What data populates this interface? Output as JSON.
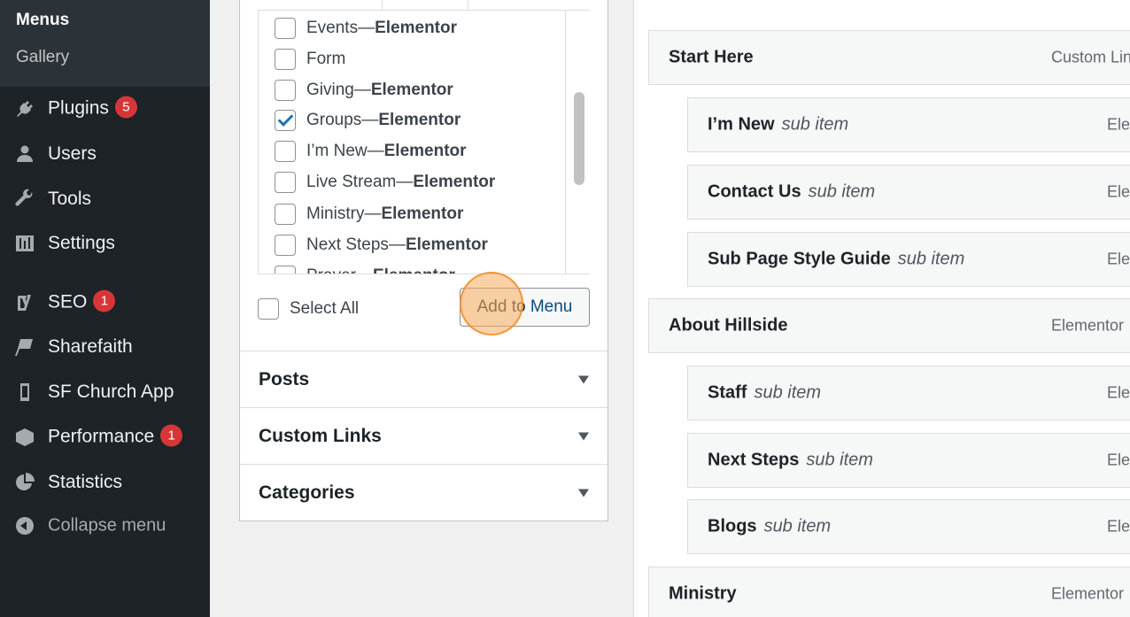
{
  "sidebar": {
    "submenu": [
      {
        "label": "Menus",
        "current": true
      },
      {
        "label": "Gallery",
        "current": false
      }
    ],
    "items": [
      {
        "label": "Plugins",
        "badge": "5",
        "icon": "plugins-icon"
      },
      {
        "label": "Users",
        "badge": "",
        "icon": "users-icon"
      },
      {
        "label": "Tools",
        "badge": "",
        "icon": "tools-icon"
      },
      {
        "label": "Settings",
        "badge": "",
        "icon": "settings-icon"
      },
      {
        "label": "SEO",
        "badge": "1",
        "icon": "yoast-seo-icon"
      },
      {
        "label": "Sharefaith",
        "badge": "",
        "icon": "sharefaith-icon"
      },
      {
        "label": "SF Church App",
        "badge": "",
        "icon": "mobile-app-icon"
      },
      {
        "label": "Performance",
        "badge": "1",
        "icon": "performance-icon"
      },
      {
        "label": "Statistics",
        "badge": "",
        "icon": "pie-chart-icon"
      },
      {
        "label": "Collapse menu",
        "badge": "",
        "icon": "collapse-arrow-icon"
      }
    ]
  },
  "pages": {
    "items": [
      {
        "name": "Events",
        "type": "Elementor",
        "checked": false
      },
      {
        "name": "Form",
        "type": "",
        "checked": false
      },
      {
        "name": "Giving",
        "type": "Elementor",
        "checked": false
      },
      {
        "name": "Groups",
        "type": "Elementor",
        "checked": true
      },
      {
        "name": "I’m New",
        "type": "Elementor",
        "checked": false
      },
      {
        "name": "Live Stream",
        "type": "Elementor",
        "checked": false
      },
      {
        "name": "Ministry",
        "type": "Elementor",
        "checked": false
      },
      {
        "name": "Next Steps",
        "type": "Elementor",
        "checked": false
      },
      {
        "name": "Prayer",
        "type": "Elementor",
        "checked": false
      }
    ],
    "separator": " — ",
    "select_all_label": "Select All",
    "add_button": {
      "part1": "Add to ",
      "part2": "Menu"
    }
  },
  "accordion": [
    {
      "title": "Posts"
    },
    {
      "title": "Custom Links"
    },
    {
      "title": "Categories"
    }
  ],
  "structure": {
    "items": [
      {
        "title": "Start Here",
        "sub": "",
        "type": "Custom Link",
        "level": 0
      },
      {
        "title": "I’m New",
        "sub": "sub item",
        "type": "Elementor",
        "level": 1
      },
      {
        "title": "Contact Us",
        "sub": "sub item",
        "type": "Elementor",
        "level": 1
      },
      {
        "title": "Sub Page Style Guide",
        "sub": "sub item",
        "type": "Elementor",
        "level": 1
      },
      {
        "title": "About Hillside",
        "sub": "",
        "type": "Elementor",
        "level": 0
      },
      {
        "title": "Staff",
        "sub": "sub item",
        "type": "Elementor",
        "level": 1
      },
      {
        "title": "Next Steps",
        "sub": "sub item",
        "type": "Elementor",
        "level": 1
      },
      {
        "title": "Blogs",
        "sub": "sub item",
        "type": "Elementor",
        "level": 1
      },
      {
        "title": "Ministry",
        "sub": "",
        "type": "Elementor",
        "level": 0
      }
    ]
  },
  "colors": {
    "sidebar_bg": "#1d2327",
    "submenu_bg": "#2c3338",
    "badge": "#d63638",
    "link_blue": "#2271b1",
    "click_indicator": "#f7ab5c"
  }
}
